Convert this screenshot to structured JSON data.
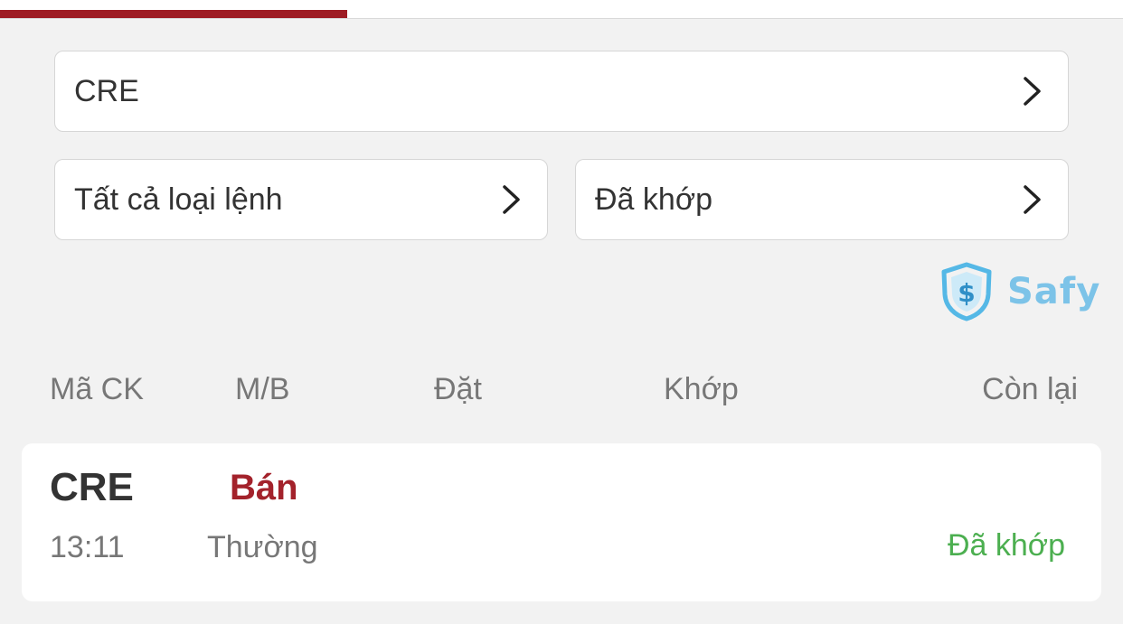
{
  "filters": {
    "symbol": "CRE",
    "order_type": "Tất cả loại lệnh",
    "status": "Đã khớp"
  },
  "branding": {
    "name": "Safy",
    "icon": "dollar-shield-icon",
    "color": "#7cc3e8"
  },
  "table": {
    "headers": {
      "code": "Mã CK",
      "side": "M/B",
      "price": "Đặt",
      "matched": "Khớp",
      "remaining": "Còn lại"
    }
  },
  "order": {
    "code": "CRE",
    "side": "Bán",
    "time": "13:11",
    "kind": "Thường",
    "status": "Đã khớp"
  },
  "colors": {
    "accent": "#9e1c24",
    "sell": "#a3222b",
    "matched": "#4caf50"
  }
}
